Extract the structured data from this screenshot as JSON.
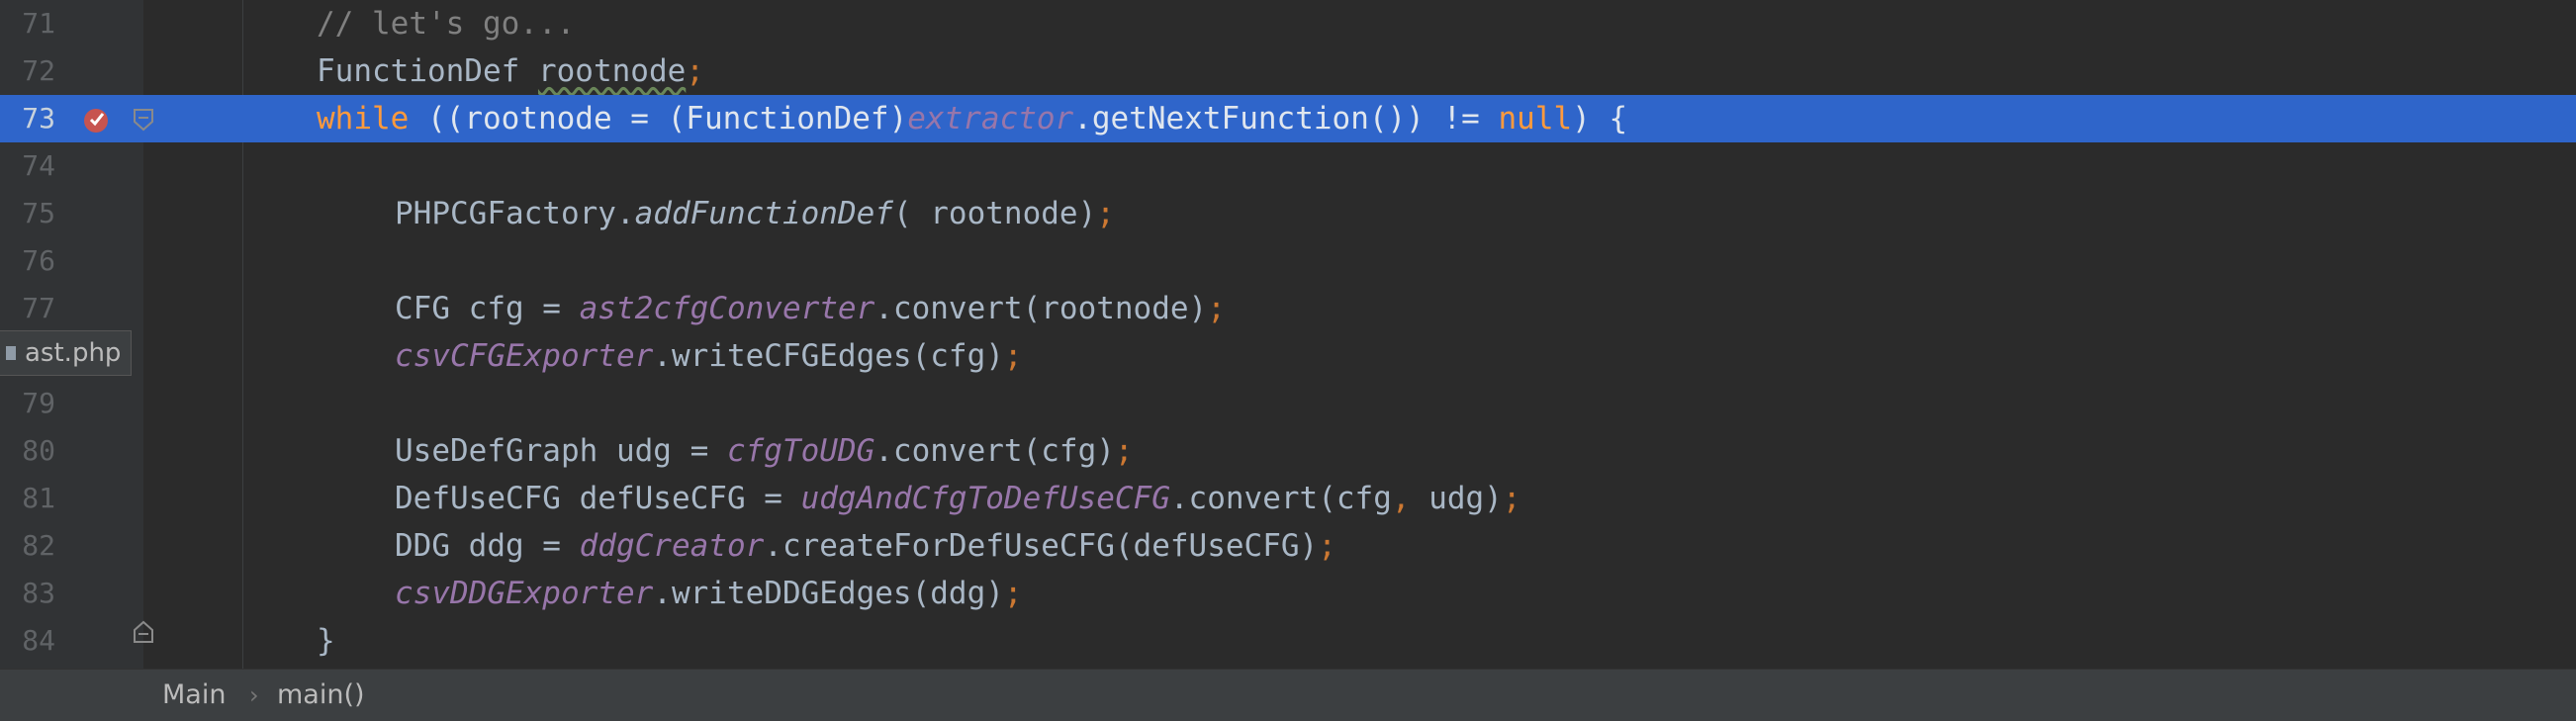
{
  "colors": {
    "editor_bg": "#2b2b2b",
    "current_line": "#2f65ca",
    "keyword": "#cc7832",
    "comment": "#808080",
    "field": "#9876aa",
    "plain": "#a9b7c6",
    "line_number": "#606366"
  },
  "lines": [
    {
      "number": "71",
      "tokens": [
        {
          "t": "// let's go...",
          "c": "comment"
        }
      ]
    },
    {
      "number": "72",
      "tokens": [
        {
          "t": "FunctionDef ",
          "c": "plain"
        },
        {
          "t": "rootnode",
          "c": "plain squiggle"
        },
        {
          "t": ";",
          "c": "punct"
        }
      ]
    },
    {
      "number": "73",
      "tokens": [
        {
          "t": "while",
          "c": "keyword"
        },
        {
          "t": " ((rootnode = (FunctionDef)",
          "c": "plain"
        },
        {
          "t": "extractor",
          "c": "field"
        },
        {
          "t": ".getNextFunction()) != ",
          "c": "plain"
        },
        {
          "t": "null",
          "c": "keyword"
        },
        {
          "t": ") {",
          "c": "plain"
        }
      ]
    },
    {
      "number": "74",
      "tokens": []
    },
    {
      "number": "75",
      "tokens": [
        {
          "t": "PHPCGFactory.",
          "c": "plain"
        },
        {
          "t": "addFunctionDef",
          "c": "static"
        },
        {
          "t": "( rootnode)",
          "c": "plain"
        },
        {
          "t": ";",
          "c": "punct"
        }
      ]
    },
    {
      "number": "76",
      "tokens": []
    },
    {
      "number": "77",
      "tokens": [
        {
          "t": "CFG cfg = ",
          "c": "plain"
        },
        {
          "t": "ast2cfgConverter",
          "c": "field"
        },
        {
          "t": ".convert(rootnode)",
          "c": "plain"
        },
        {
          "t": ";",
          "c": "punct"
        }
      ]
    },
    {
      "number": "78",
      "tokens": [
        {
          "t": "csvCFGExporter",
          "c": "field"
        },
        {
          "t": ".writeCFGEdges(cfg)",
          "c": "plain"
        },
        {
          "t": ";",
          "c": "punct"
        }
      ]
    },
    {
      "number": "79",
      "tokens": []
    },
    {
      "number": "80",
      "tokens": [
        {
          "t": "UseDefGraph udg = ",
          "c": "plain"
        },
        {
          "t": "cfgToUDG",
          "c": "field"
        },
        {
          "t": ".convert(cfg)",
          "c": "plain"
        },
        {
          "t": ";",
          "c": "punct"
        }
      ]
    },
    {
      "number": "81",
      "tokens": [
        {
          "t": "DefUseCFG defUseCFG = ",
          "c": "plain"
        },
        {
          "t": "udgAndCfgToDefUseCFG",
          "c": "field"
        },
        {
          "t": ".convert(cfg",
          "c": "plain"
        },
        {
          "t": ",",
          "c": "punct"
        },
        {
          "t": " udg)",
          "c": "plain"
        },
        {
          "t": ";",
          "c": "punct"
        }
      ]
    },
    {
      "number": "82",
      "tokens": [
        {
          "t": "DDG ddg = ",
          "c": "plain"
        },
        {
          "t": "ddgCreator",
          "c": "field"
        },
        {
          "t": ".createForDefUseCFG(defUseCFG)",
          "c": "plain"
        },
        {
          "t": ";",
          "c": "punct"
        }
      ]
    },
    {
      "number": "83",
      "tokens": [
        {
          "t": "csvDDGExporter",
          "c": "field"
        },
        {
          "t": ".writeDDGEdges(ddg)",
          "c": "plain"
        },
        {
          "t": ";",
          "c": "punct"
        }
      ]
    },
    {
      "number": "84",
      "tokens": [
        {
          "t": "}",
          "c": "plain"
        }
      ]
    }
  ],
  "indent_levels": [
    0,
    0,
    0,
    0,
    1,
    0,
    1,
    1,
    0,
    1,
    1,
    1,
    1,
    0
  ],
  "current_line_index": 2,
  "tooltip": {
    "label": "ast.php"
  },
  "breadcrumb": {
    "class_name": "Main",
    "separator": "›",
    "method_name": "main()"
  }
}
